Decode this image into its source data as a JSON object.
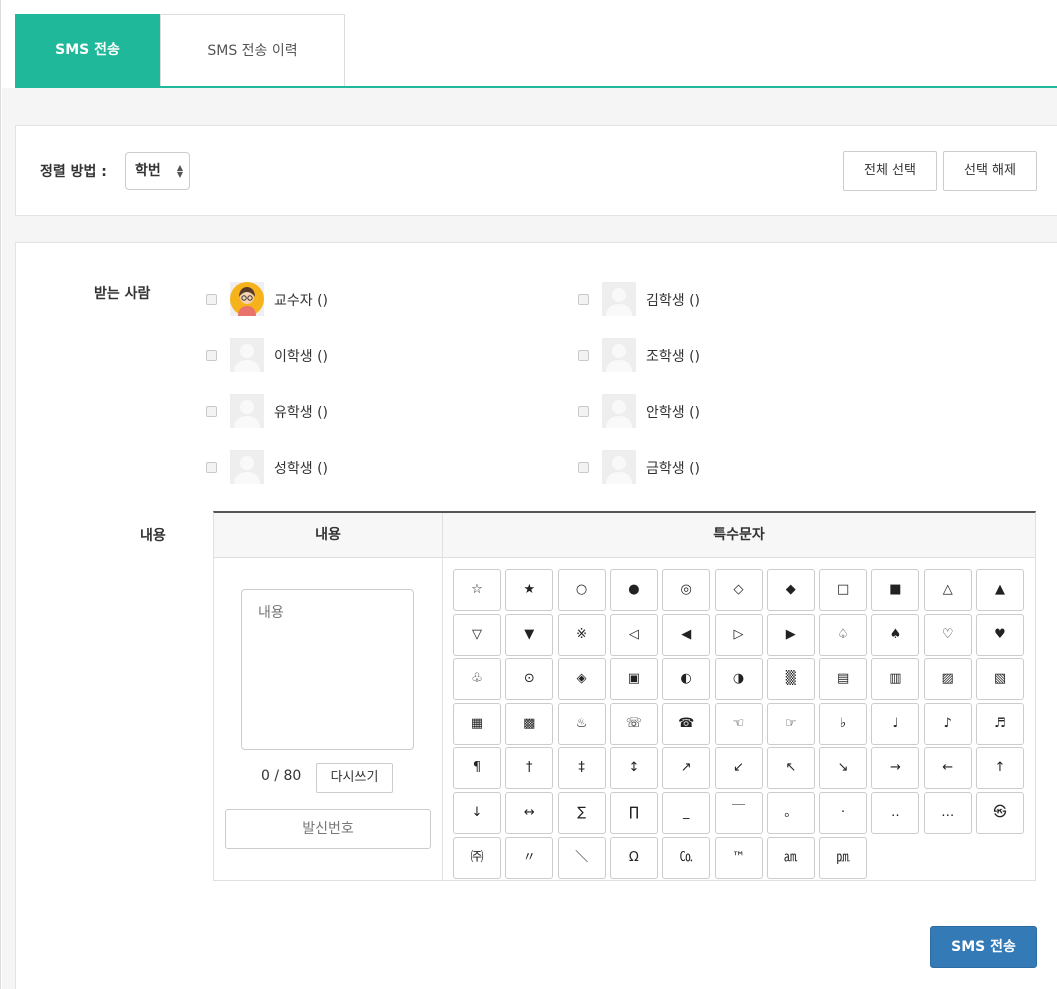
{
  "tabs": {
    "send": "SMS 전송",
    "history": "SMS 전송 이력"
  },
  "sort": {
    "label": "정렬 방법 :",
    "value": "학번",
    "select_all": "전체 선택",
    "deselect": "선택 해제"
  },
  "recipients": {
    "label": "받는 사람",
    "items": [
      {
        "name": "교수자 ()",
        "avatar": "professor-avatar"
      },
      {
        "name": "김학생 ()",
        "avatar": "default-avatar"
      },
      {
        "name": "이학생 ()",
        "avatar": "default-avatar"
      },
      {
        "name": "조학생 ()",
        "avatar": "default-avatar"
      },
      {
        "name": "유학생 ()",
        "avatar": "default-avatar"
      },
      {
        "name": "안학생 ()",
        "avatar": "default-avatar"
      },
      {
        "name": "성학생 ()",
        "avatar": "default-avatar"
      },
      {
        "name": "금학생 ()",
        "avatar": "default-avatar"
      }
    ]
  },
  "content": {
    "label": "내용",
    "col_content": "내용",
    "col_special": "특수문자",
    "placeholder": "내용",
    "counter": "0 / 80",
    "rewrite": "다시쓰기",
    "sender": "발신번호"
  },
  "symbols": [
    "☆",
    "★",
    "○",
    "●",
    "◎",
    "◇",
    "◆",
    "□",
    "■",
    "△",
    "▲",
    "▽",
    "▼",
    "※",
    "◁",
    "◀",
    "▷",
    "▶",
    "♤",
    "♠",
    "♡",
    "♥",
    "♧",
    "⊙",
    "◈",
    "▣",
    "◐",
    "◑",
    "▒",
    "▤",
    "▥",
    "▨",
    "▧",
    "▦",
    "▩",
    "♨",
    "☏",
    "☎",
    "☜",
    "☞",
    "♭",
    "♩",
    "♪",
    "♬",
    "¶",
    "†",
    "‡",
    "↕",
    "↗",
    "↙",
    "↖",
    "↘",
    "→",
    "←",
    "↑",
    "↓",
    "↔",
    "∑",
    "∏",
    "_",
    "￣",
    "。",
    "·",
    "‥",
    "…",
    "㉿",
    "㈜",
    "〃",
    "＼",
    "Ω",
    "㏇",
    "™",
    "㏂",
    "㏘"
  ],
  "send_button": "SMS 전송",
  "colors": {
    "accent": "#1fb89a",
    "primary": "#337ab7"
  }
}
